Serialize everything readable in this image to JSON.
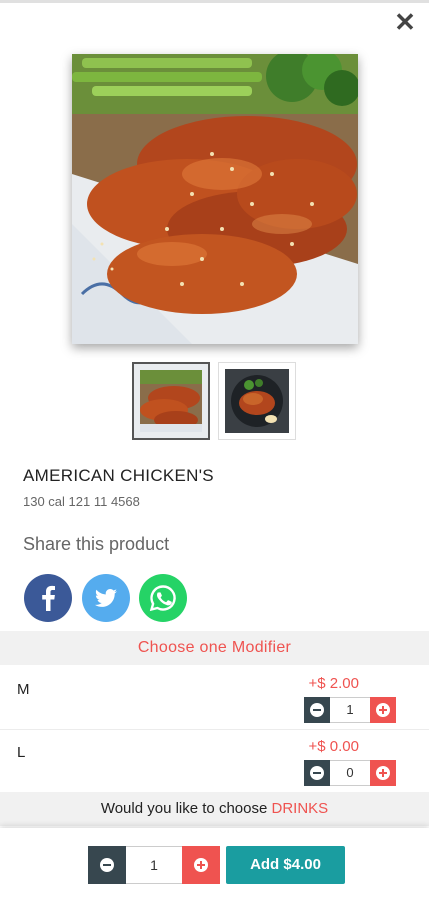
{
  "header": {
    "close_glyph": "✕",
    "close_icon": "close-icon"
  },
  "product": {
    "name": "AMERICAN CHICKEN'S",
    "meta": "130 cal 121 11 4568"
  },
  "share": {
    "title": "Share this product",
    "networks": [
      {
        "name": "facebook-icon",
        "color": "#3b5998"
      },
      {
        "name": "twitter-icon",
        "color": "#55acee"
      },
      {
        "name": "whatsapp-icon",
        "color": "#25d366"
      }
    ]
  },
  "modifier": {
    "heading": "Choose one Modifier",
    "options": [
      {
        "label": "M",
        "price": "+$ 2.00",
        "qty": "1"
      },
      {
        "label": "L",
        "price": "+$ 0.00",
        "qty": "0"
      }
    ]
  },
  "drinks": {
    "prefix": "Would you like to choose ",
    "accent": "DRINKS"
  },
  "cart": {
    "qty": "1",
    "add_label": "Add $4.00"
  },
  "colors": {
    "accent_red": "#ef5350",
    "dark_slate": "#37474f",
    "teal": "#1a9da0"
  }
}
